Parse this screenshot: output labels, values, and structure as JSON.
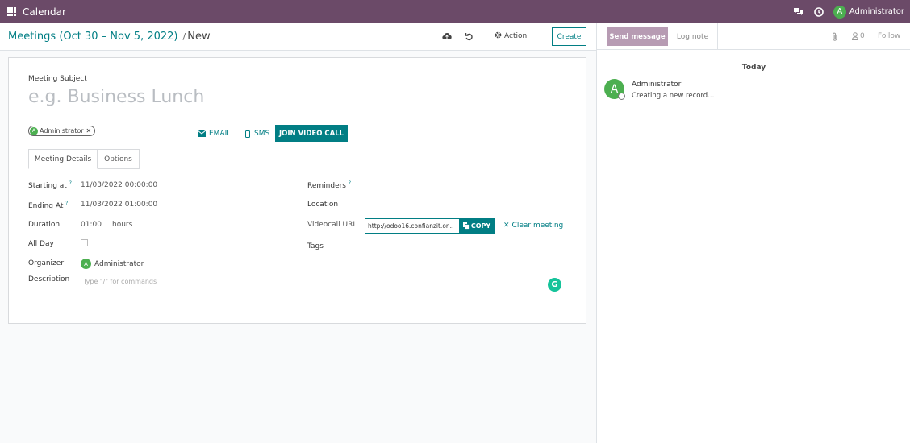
{
  "navbar": {
    "app_title": "Calendar",
    "user_initial": "A",
    "user_name": "Administrator"
  },
  "control_panel": {
    "breadcrumb_parent": "Meetings (Oct 30 – Nov 5, 2022)",
    "breadcrumb_separator": "/",
    "breadcrumb_current": "New",
    "action_label": "Action",
    "create_label": "Create"
  },
  "form": {
    "subject_label": "Meeting Subject",
    "subject_placeholder": "e.g. Business Lunch",
    "attendee_initial": "A",
    "attendee_name": "Administrator",
    "email_label": "EMAIL",
    "sms_label": "SMS",
    "join_label": "JOIN VIDEO CALL",
    "tabs": [
      "Meeting Details",
      "Options"
    ],
    "left_fields": {
      "starting_label": "Starting at",
      "starting_value": "11/03/2022 00:00:00",
      "ending_label": "Ending At",
      "ending_value": "11/03/2022 01:00:00",
      "duration_label": "Duration",
      "duration_value": "01:00",
      "duration_unit": "hours",
      "allday_label": "All Day",
      "organizer_label": "Organizer",
      "organizer_initial": "A",
      "organizer_name": "Administrator",
      "description_label": "Description",
      "description_placeholder": "Type \"/\" for commands"
    },
    "right_fields": {
      "reminders_label": "Reminders",
      "location_label": "Location",
      "videocall_label": "Videocall URL",
      "videocall_value": "http://odoo16.confianzit.or...",
      "copy_label": "COPY",
      "clear_label": "Clear meeting",
      "tags_label": "Tags"
    },
    "help_mark": "?",
    "grammarly_letter": "G"
  },
  "chatter": {
    "send_message_label": "Send message",
    "log_note_label": "Log note",
    "followers_count": "0",
    "follow_label": "Follow",
    "today_label": "Today",
    "message": {
      "avatar_initial": "A",
      "author": "Administrator",
      "body": "Creating a new record..."
    }
  },
  "colors": {
    "navbar": "#6b4a68",
    "accent": "#017e84",
    "avatar_green": "#4caf50",
    "send_button": "#b79bb3"
  },
  "icons": [
    "apps-grid-icon",
    "chat-icon",
    "clock-icon",
    "cloud-upload-icon",
    "discard-icon",
    "gear-icon",
    "envelope-icon",
    "mobile-icon",
    "copy-icon",
    "close-icon",
    "paperclip-icon",
    "user-icon",
    "grammarly-icon"
  ]
}
